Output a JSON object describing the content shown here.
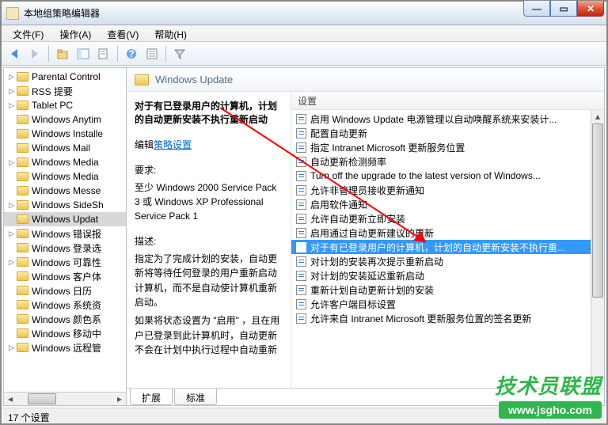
{
  "window": {
    "title": "本地组策略编辑器"
  },
  "menu": {
    "file": "文件(F)",
    "action": "操作(A)",
    "view": "查看(V)",
    "help": "帮助(H)"
  },
  "tree": [
    {
      "label": "Parental Control",
      "expand": "▷"
    },
    {
      "label": "RSS 提要",
      "expand": "▷"
    },
    {
      "label": "Tablet PC",
      "expand": "▷"
    },
    {
      "label": "Windows Anytim",
      "expand": ""
    },
    {
      "label": "Windows Installe",
      "expand": ""
    },
    {
      "label": "Windows Mail",
      "expand": ""
    },
    {
      "label": "Windows Media",
      "expand": "▷"
    },
    {
      "label": "Windows Media",
      "expand": ""
    },
    {
      "label": "Windows Messe",
      "expand": ""
    },
    {
      "label": "Windows SideSh",
      "expand": "▷"
    },
    {
      "label": "Windows Updat",
      "expand": "",
      "selected": true
    },
    {
      "label": "Windows 错误报",
      "expand": "▷"
    },
    {
      "label": "Windows 登录选",
      "expand": ""
    },
    {
      "label": "Windows 可靠性",
      "expand": "▷"
    },
    {
      "label": "Windows 客户体",
      "expand": ""
    },
    {
      "label": "Windows 日历",
      "expand": ""
    },
    {
      "label": "Windows 系统资",
      "expand": ""
    },
    {
      "label": "Windows 颜色系",
      "expand": ""
    },
    {
      "label": "Windows 移动中",
      "expand": ""
    },
    {
      "label": "Windows 远程管",
      "expand": "▷"
    }
  ],
  "details": {
    "header": "Windows Update",
    "policy": {
      "heading": "对于有已登录用户的计算机，计划的自动更新安装不执行重新启动",
      "edit_label": "编辑",
      "edit_link": "策略设置",
      "req_label": "要求:",
      "req_body": "至少 Windows 2000 Service Pack 3 或 Windows XP Professional Service Pack 1",
      "desc_label": "描述:",
      "desc_body": "指定为了完成计划的安装，自动更新将等待任何登录的用户重新启动计算机，而不是自动使计算机重新启动。",
      "desc_body2": "如果将状态设置为 \"启用\" ，且在用户已登录到此计算机时，自动更新不会在计划中执行过程中自动重新"
    },
    "col_header": "设置",
    "items": [
      "启用 Windows Update 电源管理以自动唤醒系统来安装计...",
      "配置自动更新",
      "指定 Intranet Microsoft 更新服务位置",
      "自动更新检测频率",
      "Turn off the upgrade to the latest version of Windows...",
      "允许非管理员接收更新通知",
      "启用软件通知",
      "允许自动更新立即安装",
      "启用通过自动更新建议的更新",
      "对于有已登录用户的计算机，计划的自动更新安装不执行重...",
      "对计划的安装再次提示重新启动",
      "对计划的安装延迟重新启动",
      "重新计划自动更新计划的安装",
      "允许客户端目标设置",
      "允许来自 Intranet Microsoft 更新服务位置的签名更新"
    ],
    "selected_index": 9
  },
  "tabs": {
    "extended": "扩展",
    "standard": "标准"
  },
  "status": "17 个设置",
  "watermark": {
    "big": "技术员联盟",
    "url": "www.jsgho.com"
  }
}
